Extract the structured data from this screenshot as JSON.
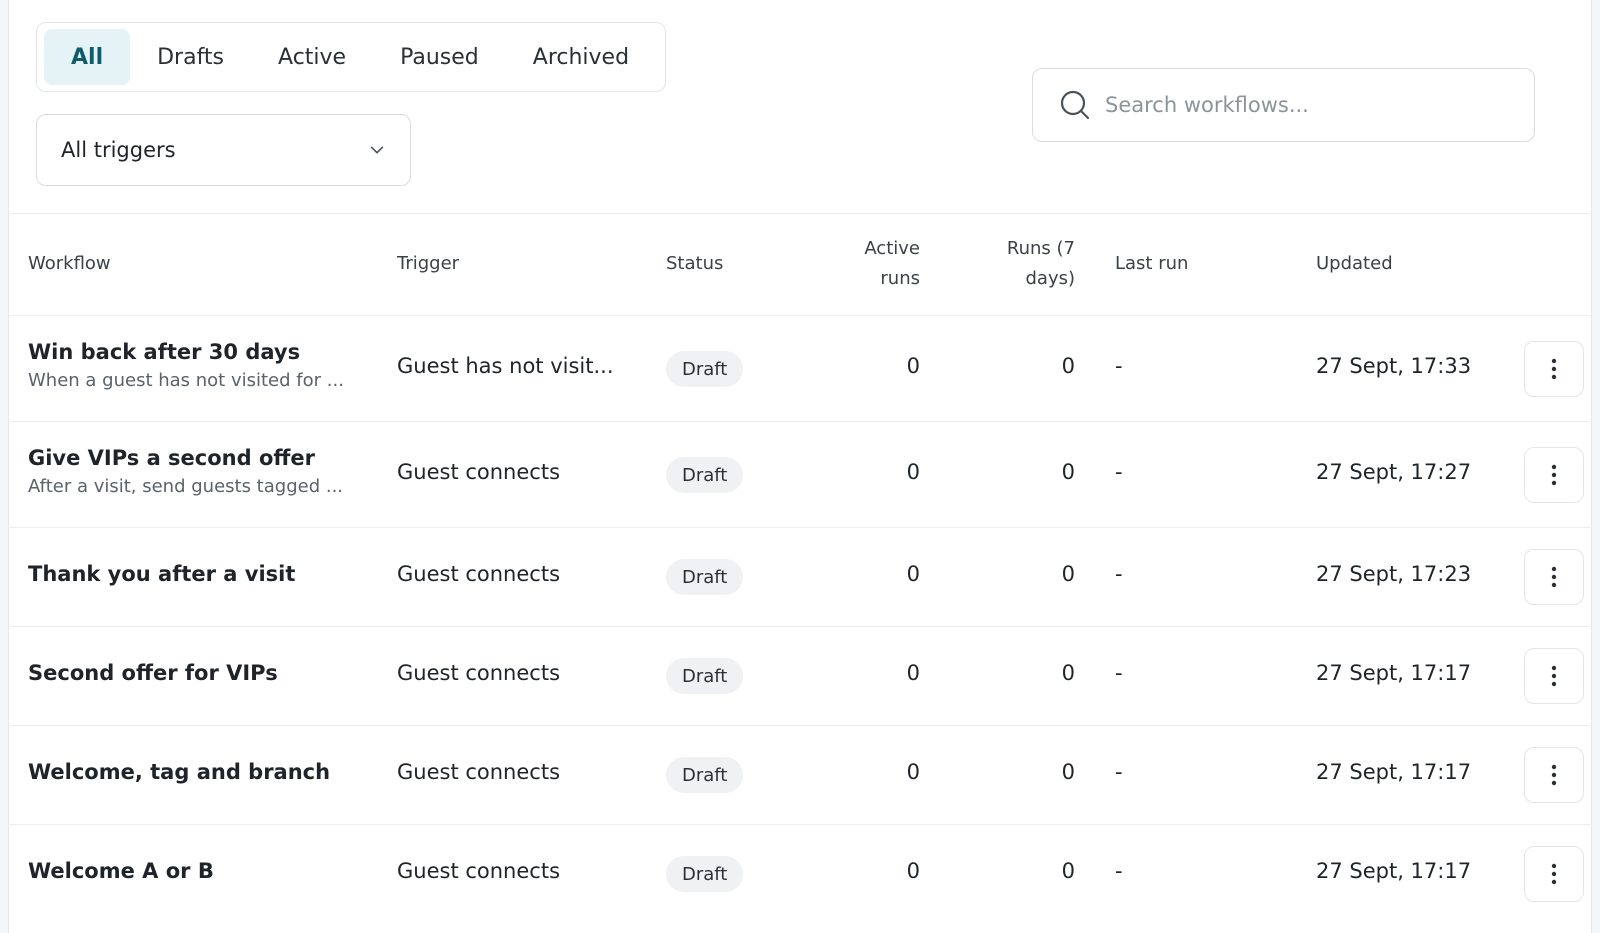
{
  "tabs": [
    {
      "label": "All",
      "active": true
    },
    {
      "label": "Drafts",
      "active": false
    },
    {
      "label": "Active",
      "active": false
    },
    {
      "label": "Paused",
      "active": false
    },
    {
      "label": "Archived",
      "active": false
    }
  ],
  "trigger_filter": {
    "value": "All triggers"
  },
  "search": {
    "placeholder": "Search workflows..."
  },
  "table": {
    "headers": {
      "workflow": "Workflow",
      "trigger": "Trigger",
      "status": "Status",
      "active_runs_1": "Active",
      "active_runs_2": "runs",
      "runs7_1": "Runs (7",
      "runs7_2": "days)",
      "last_run": "Last run",
      "updated": "Updated"
    },
    "rows": [
      {
        "title": "Win back after 30 days",
        "subtitle": "When a guest has not visited for ...",
        "trigger": "Guest has not visit...",
        "status": "Draft",
        "active_runs": "0",
        "runs_7d": "0",
        "last_run": "-",
        "updated": "27 Sept, 17:33"
      },
      {
        "title": "Give VIPs a second offer",
        "subtitle": "After a visit, send guests tagged ...",
        "trigger": "Guest connects",
        "status": "Draft",
        "active_runs": "0",
        "runs_7d": "0",
        "last_run": "-",
        "updated": "27 Sept, 17:27"
      },
      {
        "title": "Thank you after a visit",
        "subtitle": "",
        "trigger": "Guest connects",
        "status": "Draft",
        "active_runs": "0",
        "runs_7d": "0",
        "last_run": "-",
        "updated": "27 Sept, 17:23"
      },
      {
        "title": "Second offer for VIPs",
        "subtitle": "",
        "trigger": "Guest connects",
        "status": "Draft",
        "active_runs": "0",
        "runs_7d": "0",
        "last_run": "-",
        "updated": "27 Sept, 17:17"
      },
      {
        "title": "Welcome, tag and branch",
        "subtitle": "",
        "trigger": "Guest connects",
        "status": "Draft",
        "active_runs": "0",
        "runs_7d": "0",
        "last_run": "-",
        "updated": "27 Sept, 17:17"
      },
      {
        "title": "Welcome A or B",
        "subtitle": "",
        "trigger": "Guest connects",
        "status": "Draft",
        "active_runs": "0",
        "runs_7d": "0",
        "last_run": "-",
        "updated": "27 Sept, 17:17"
      }
    ]
  },
  "icons": {
    "search": "search-icon",
    "chevron": "chevron-down-icon",
    "menu": "more-vertical-icon"
  },
  "colors": {
    "accent_bg": "#e6f3f6",
    "accent_text": "#0e5b6b",
    "badge_bg": "#f0f1f2"
  }
}
